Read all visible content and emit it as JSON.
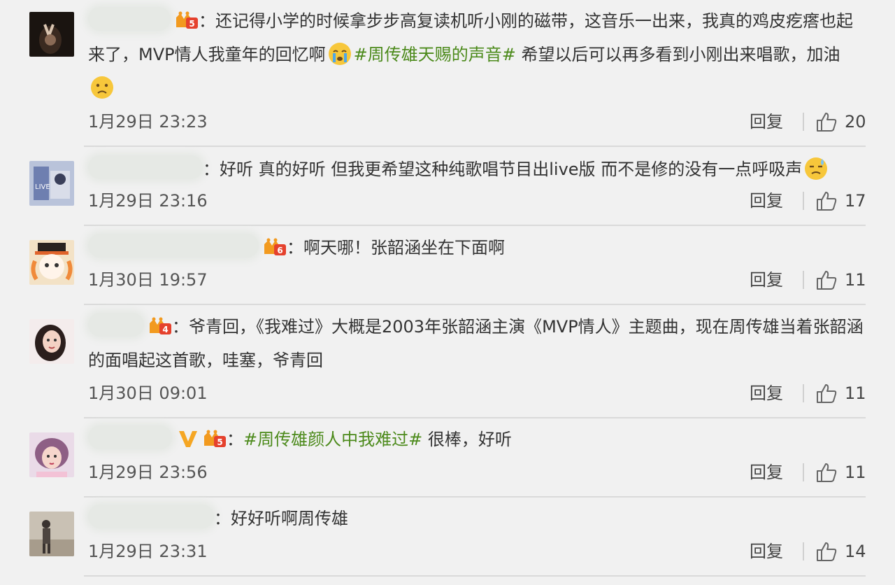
{
  "comments": [
    {
      "badge": "crown-fan",
      "colon": "：",
      "text_a": "还记得小学的时候拿步步高复读机听小刚的磁带，这音乐一出来，我真的鸡皮疙瘩也起来了，MVP情人我童年的回忆啊",
      "emoji_a": "crying-face",
      "topic": "#周传雄天赐的声音#",
      "text_b": " 希望以后可以再多看到小刚出来唱歌，加油",
      "emoji_b": "sad-face",
      "time": "1月29日 23:23",
      "reply_label": "回复",
      "likes": "20"
    },
    {
      "colon": "：",
      "text_a": "好听 真的好听 但我更希望这种纯歌唱节目出live版 而不是修的没有一点呼吸声",
      "emoji_a": "sweat-face",
      "time": "1月29日 23:16",
      "reply_label": "回复",
      "likes": "17"
    },
    {
      "badge": "crown-fan",
      "colon": "：",
      "text_a": "啊天哪！张韶涵坐在下面啊",
      "time": "1月30日 19:57",
      "reply_label": "回复",
      "likes": "11"
    },
    {
      "badge": "crown-fan",
      "colon": "：",
      "text_a": "爷青回，《我难过》大概是2003年张韶涵主演《MVP情人》主题曲，现在周传雄当着张韶涵的面唱起这首歌，哇塞，爷青回",
      "time": "1月30日 09:01",
      "reply_label": "回复",
      "likes": "11"
    },
    {
      "badge": "crown-fan",
      "verified": "V",
      "colon": "：",
      "topic": "#周传雄颜人中我难过#",
      "text_b": " 很棒，好听",
      "time": "1月29日 23:56",
      "reply_label": "回复",
      "likes": "11"
    },
    {
      "colon": "：",
      "text_a": "好好听啊周传雄",
      "time": "1月29日 23:31",
      "reply_label": "回复",
      "likes": "14"
    }
  ],
  "icons": {
    "like": "thumbs-up-icon",
    "badge": "crown-fan-badge-icon",
    "verified": "verified-v-icon"
  },
  "colors": {
    "background": "#f1f1f1",
    "topic": "#4c8a1b",
    "badge_orange": "#f29a1f",
    "badge_red": "#e5412d",
    "verified_gold": "#f5a623"
  }
}
